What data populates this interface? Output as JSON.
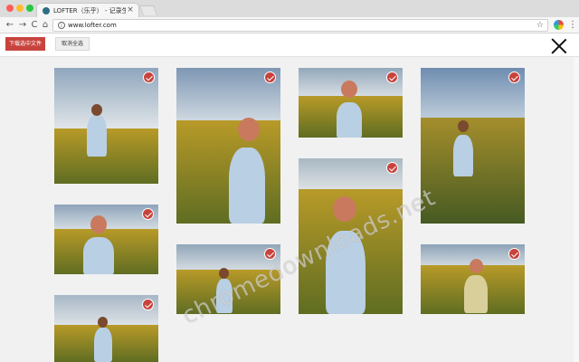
{
  "browser": {
    "tab_title": "LOFTER（乐乎） - 记录生活,",
    "tab_close": "×",
    "url": "www.lofter.com",
    "back": "←",
    "forward": "→",
    "reload": "C",
    "home": "⌂",
    "info": "i",
    "star": "☆",
    "menu": "⋮"
  },
  "actions": {
    "download_label": "下载选中文件",
    "deselect_label": "取消全选"
  },
  "watermark": "chromedownloads.net",
  "colors": {
    "accent": "#c8433d",
    "check": "#c8433d"
  },
  "photos": [
    {
      "name": "photo-1",
      "selected": true
    },
    {
      "name": "photo-2",
      "selected": true
    },
    {
      "name": "photo-3",
      "selected": true
    },
    {
      "name": "photo-4",
      "selected": true
    },
    {
      "name": "photo-5",
      "selected": true
    },
    {
      "name": "photo-6",
      "selected": true
    },
    {
      "name": "photo-7",
      "selected": true
    },
    {
      "name": "photo-8",
      "selected": true
    },
    {
      "name": "photo-9",
      "selected": true
    }
  ]
}
